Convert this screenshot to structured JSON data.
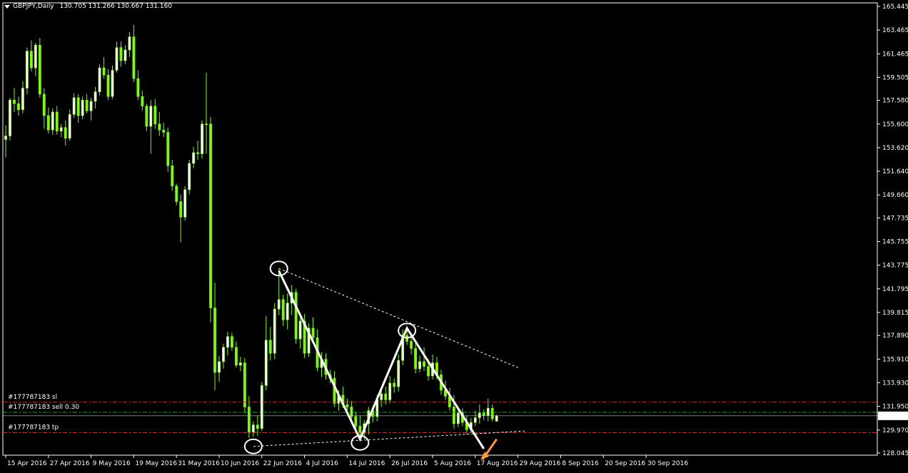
{
  "header": {
    "symbol": "GBPJPY,Daily",
    "ohlc": "130.705 131.266 130.667 131.160"
  },
  "colors": {
    "background": "#000000",
    "frame": "#ffffff",
    "candle": "#7cfc00",
    "bull_body": "#ffffff",
    "bear_body": "#7cfc00",
    "sl_tp_line": "#ff2020",
    "entry_line": "#00c000",
    "annotation": "#ffffff",
    "arrow": "#ff9933"
  },
  "chart_data": {
    "type": "candlestick",
    "symbol": "GBPJPY",
    "timeframe": "Daily",
    "ylim": [
      127.5,
      165.8
    ],
    "y_ticks": [
      "165.445",
      "163.465",
      "161.465",
      "159.505",
      "157.580",
      "155.600",
      "153.620",
      "151.640",
      "149.660",
      "147.735",
      "145.755",
      "143.775",
      "141.795",
      "139.815",
      "137.890",
      "135.910",
      "133.930",
      "131.950",
      "129.970",
      "128.045"
    ],
    "x_ticks": [
      "15 Apr 2016",
      "27 Apr 2016",
      "9 May 2016",
      "19 May 2016",
      "31 May 2016",
      "10 Jun 2016",
      "22 Jun 2016",
      "4 Jul 2016",
      "14 Jul 2016",
      "26 Jul 2016",
      "5 Aug 2016",
      "17 Aug 2016",
      "29 Aug 2016",
      "8 Sep 2016",
      "20 Sep 2016",
      "30 Sep 2016"
    ],
    "candles": [
      [
        154.3,
        155.5,
        152.8,
        154.6
      ],
      [
        154.6,
        157.8,
        154.2,
        157.6
      ],
      [
        157.6,
        158.6,
        156.6,
        157.3
      ],
      [
        157.3,
        157.9,
        156.3,
        156.8
      ],
      [
        156.8,
        159.2,
        156.5,
        158.6
      ],
      [
        158.6,
        162.0,
        158.1,
        161.7
      ],
      [
        161.7,
        162.6,
        160.0,
        160.3
      ],
      [
        160.3,
        162.4,
        159.6,
        162.2
      ],
      [
        162.2,
        162.8,
        157.8,
        158.1
      ],
      [
        158.1,
        158.6,
        155.2,
        156.3
      ],
      [
        156.3,
        157.0,
        154.8,
        155.1
      ],
      [
        155.1,
        156.9,
        154.7,
        156.6
      ],
      [
        156.6,
        157.1,
        154.7,
        155.0
      ],
      [
        155.0,
        155.6,
        154.5,
        155.3
      ],
      [
        155.3,
        155.9,
        153.8,
        154.4
      ],
      [
        154.4,
        156.8,
        154.2,
        156.4
      ],
      [
        156.4,
        158.2,
        156.1,
        157.8
      ],
      [
        157.8,
        158.1,
        155.7,
        156.3
      ],
      [
        156.3,
        157.9,
        156.0,
        157.6
      ],
      [
        157.6,
        158.1,
        156.5,
        156.7
      ],
      [
        156.7,
        157.8,
        155.9,
        157.5
      ],
      [
        157.5,
        158.7,
        156.9,
        158.3
      ],
      [
        158.3,
        160.6,
        158.0,
        160.3
      ],
      [
        160.3,
        161.2,
        159.4,
        159.7
      ],
      [
        159.7,
        160.2,
        157.6,
        157.9
      ],
      [
        157.9,
        160.5,
        157.7,
        160.1
      ],
      [
        160.1,
        162.5,
        159.9,
        162.0
      ],
      [
        162.0,
        162.5,
        160.4,
        160.9
      ],
      [
        160.9,
        162.2,
        160.6,
        161.8
      ],
      [
        161.8,
        163.3,
        161.2,
        162.9
      ],
      [
        162.9,
        163.9,
        159.1,
        159.4
      ],
      [
        159.4,
        160.1,
        157.6,
        157.9
      ],
      [
        157.9,
        158.4,
        156.7,
        157.1
      ],
      [
        157.1,
        157.3,
        155.0,
        155.4
      ],
      [
        155.4,
        157.6,
        153.1,
        157.1
      ],
      [
        157.1,
        157.7,
        155.2,
        155.6
      ],
      [
        155.6,
        156.6,
        154.6,
        155.1
      ],
      [
        155.1,
        155.7,
        154.5,
        154.9
      ],
      [
        154.9,
        155.3,
        151.6,
        152.1
      ],
      [
        152.1,
        152.6,
        150.0,
        150.4
      ],
      [
        150.4,
        150.6,
        148.8,
        149.1
      ],
      [
        149.1,
        149.7,
        145.7,
        147.8
      ],
      [
        147.8,
        150.4,
        147.5,
        150.1
      ],
      [
        150.1,
        152.6,
        149.7,
        152.3
      ],
      [
        152.3,
        153.7,
        151.9,
        153.2
      ],
      [
        153.2,
        154.2,
        152.6,
        153.1
      ],
      [
        153.1,
        155.9,
        152.7,
        155.6
      ],
      [
        155.6,
        159.9,
        153.1,
        155.6
      ],
      [
        155.6,
        156.2,
        139.0,
        140.2
      ],
      [
        140.2,
        142.3,
        133.3,
        134.8
      ],
      [
        134.8,
        136.2,
        134.0,
        135.7
      ],
      [
        135.7,
        137.2,
        135.1,
        136.9
      ],
      [
        136.9,
        138.2,
        136.2,
        137.8
      ],
      [
        137.8,
        138.1,
        136.6,
        136.9
      ],
      [
        136.9,
        137.4,
        135.2,
        135.4
      ],
      [
        135.4,
        136.1,
        134.9,
        135.6
      ],
      [
        135.6,
        136.0,
        131.4,
        131.9
      ],
      [
        131.9,
        132.8,
        129.3,
        129.8
      ],
      [
        129.8,
        130.7,
        129.4,
        130.4
      ],
      [
        130.4,
        131.2,
        129.5,
        130.1
      ],
      [
        130.1,
        134.0,
        129.9,
        133.7
      ],
      [
        133.7,
        139.5,
        133.3,
        137.5
      ],
      [
        137.5,
        138.6,
        135.8,
        136.4
      ],
      [
        136.4,
        140.6,
        135.9,
        140.1
      ],
      [
        140.1,
        143.5,
        139.6,
        140.9
      ],
      [
        140.9,
        141.3,
        138.7,
        139.2
      ],
      [
        139.2,
        141.4,
        138.4,
        140.6
      ],
      [
        140.6,
        142.1,
        139.6,
        141.5
      ],
      [
        141.5,
        141.8,
        137.2,
        137.6
      ],
      [
        137.6,
        139.6,
        136.8,
        139.1
      ],
      [
        139.1,
        139.7,
        136.0,
        136.4
      ],
      [
        136.4,
        138.9,
        136.1,
        138.5
      ],
      [
        138.5,
        139.4,
        137.2,
        137.7
      ],
      [
        137.7,
        138.4,
        134.9,
        135.2
      ],
      [
        135.2,
        136.5,
        134.4,
        135.9
      ],
      [
        135.9,
        136.4,
        134.2,
        134.6
      ],
      [
        134.6,
        135.0,
        133.9,
        134.3
      ],
      [
        134.3,
        134.9,
        131.9,
        132.2
      ],
      [
        132.2,
        133.3,
        131.6,
        132.9
      ],
      [
        132.9,
        133.6,
        131.8,
        132.1
      ],
      [
        132.1,
        132.6,
        131.6,
        131.9
      ],
      [
        131.9,
        132.4,
        130.6,
        131.1
      ],
      [
        131.1,
        131.5,
        129.9,
        130.3
      ],
      [
        130.3,
        131.2,
        129.4,
        129.7
      ],
      [
        129.7,
        130.8,
        129.2,
        130.5
      ],
      [
        130.5,
        131.9,
        129.6,
        131.6
      ],
      [
        131.6,
        132.0,
        130.6,
        131.1
      ],
      [
        131.1,
        132.9,
        130.7,
        132.5
      ],
      [
        132.5,
        133.4,
        131.9,
        133.0
      ],
      [
        133.0,
        133.6,
        132.1,
        132.5
      ],
      [
        132.5,
        134.5,
        132.2,
        133.9
      ],
      [
        133.9,
        134.3,
        133.1,
        133.6
      ],
      [
        133.6,
        136.3,
        133.2,
        135.8
      ],
      [
        135.8,
        138.4,
        135.4,
        137.9
      ],
      [
        137.9,
        138.5,
        137.1,
        137.4
      ],
      [
        137.4,
        137.9,
        136.3,
        136.8
      ],
      [
        136.8,
        137.2,
        134.7,
        135.1
      ],
      [
        135.1,
        136.2,
        134.8,
        135.7
      ],
      [
        135.7,
        136.9,
        134.9,
        135.3
      ],
      [
        135.3,
        135.9,
        134.1,
        134.5
      ],
      [
        134.5,
        136.3,
        134.2,
        135.6
      ],
      [
        135.6,
        136.1,
        134.2,
        134.6
      ],
      [
        134.6,
        135.0,
        132.9,
        133.3
      ],
      [
        133.3,
        134.1,
        132.5,
        132.8
      ],
      [
        132.8,
        133.5,
        131.6,
        131.9
      ],
      [
        131.9,
        132.9,
        130.1,
        130.5
      ],
      [
        130.5,
        131.8,
        130.2,
        131.4
      ],
      [
        131.4,
        131.8,
        130.3,
        130.6
      ],
      [
        130.6,
        131.2,
        129.6,
        130.0
      ],
      [
        130.0,
        131.0,
        129.7,
        130.6
      ],
      [
        130.6,
        131.6,
        130.3,
        131.0
      ],
      [
        131.0,
        132.1,
        130.5,
        131.4
      ],
      [
        131.4,
        131.7,
        130.8,
        131.2
      ],
      [
        131.2,
        132.6,
        130.7,
        131.8
      ],
      [
        131.8,
        132.1,
        130.7,
        130.9
      ],
      [
        130.705,
        131.266,
        130.667,
        131.16
      ]
    ],
    "orders": [
      {
        "label": "#177787183 sl",
        "price": 132.3,
        "color": "#ff2020"
      },
      {
        "label": "#177787183 sell 0.30",
        "price": 131.45,
        "color": "#00c000"
      },
      {
        "label": "#177787183 tp",
        "price": 129.75,
        "color": "#ff2020"
      }
    ],
    "current_price": "131.160"
  }
}
